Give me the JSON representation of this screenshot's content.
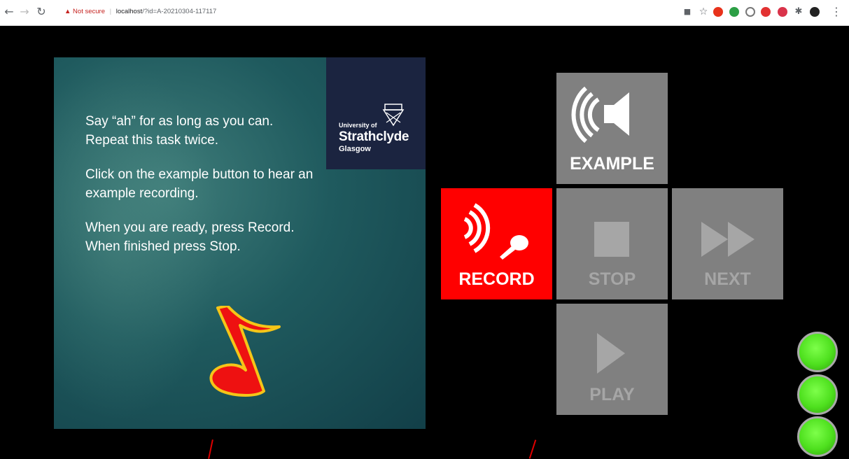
{
  "browser": {
    "warning_text": "Not secure",
    "host": "localhost",
    "path": "/?id=A-20210304-117117"
  },
  "slide": {
    "instructions": [
      "Say “ah” for as long as you can. Repeat this task twice.",
      "Click on the example button to hear an example recording.",
      "When you are ready, press Record. When finished press Stop."
    ],
    "logo": {
      "line1": "University of",
      "line2": "Strathclyde",
      "line3": "Glasgow"
    }
  },
  "controls": {
    "example_label": "EXAMPLE",
    "record_label": "RECORD",
    "stop_label": "STOP",
    "next_label": "NEXT",
    "play_label": "PLAY"
  },
  "colors": {
    "record_red": "#ff0000",
    "tile_gray": "#808080",
    "indicator_green": "#55e622",
    "logo_navy": "#1b2440"
  }
}
